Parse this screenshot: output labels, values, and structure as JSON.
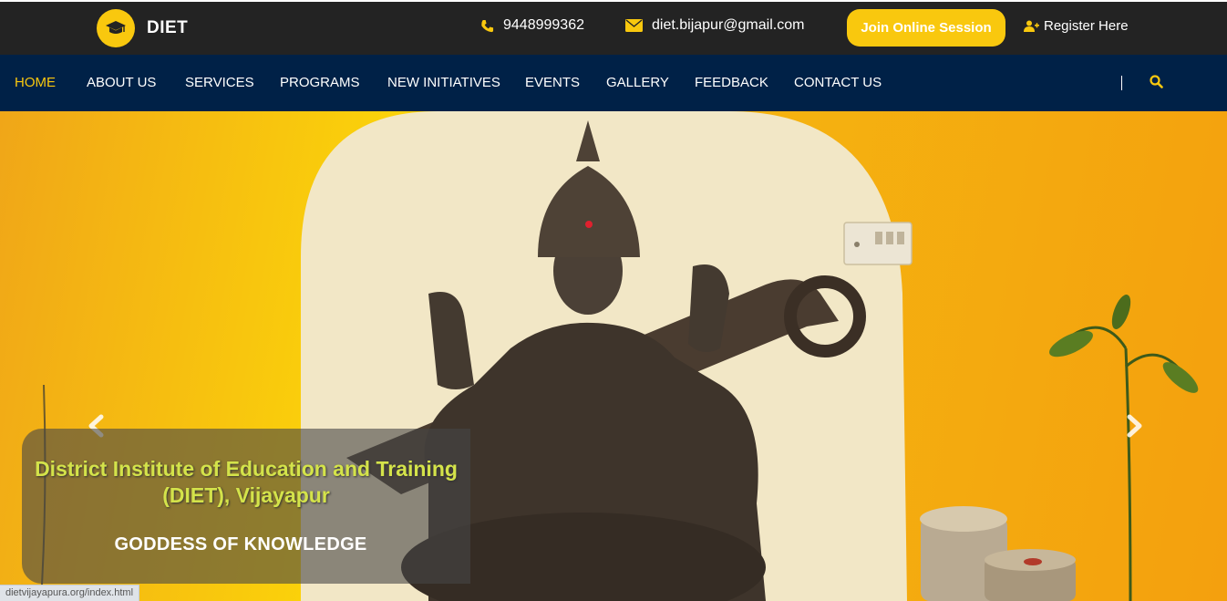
{
  "brand": {
    "name": "DIET",
    "logo_icon": "graduation-cap-icon"
  },
  "topbar": {
    "phone": "9448999362",
    "email": "diet.bijapur@gmail.com",
    "join_label": "Join Online Session",
    "register_label": "Register Here"
  },
  "nav": {
    "items": [
      "HOME",
      "ABOUT US",
      "SERVICES",
      "PROGRAMS",
      "NEW INITIATIVES",
      "EVENTS",
      "GALLERY",
      "FEEDBACK",
      "CONTACT US"
    ],
    "active": "HOME",
    "search_icon": "search-icon"
  },
  "hero": {
    "caption_title": "District Institute of Education and Training (DIET), Vijayapur",
    "caption_subtitle": "GODDESS OF KNOWLEDGE",
    "prev_icon": "chevron-left-icon",
    "next_icon": "chevron-right-icon"
  },
  "status_url": "dietvijayapura.org/index.html",
  "colors": {
    "accent": "#f9c80e",
    "topbar_bg": "#232323",
    "nav_bg": "#002147",
    "caption_text": "#d4e34a"
  }
}
